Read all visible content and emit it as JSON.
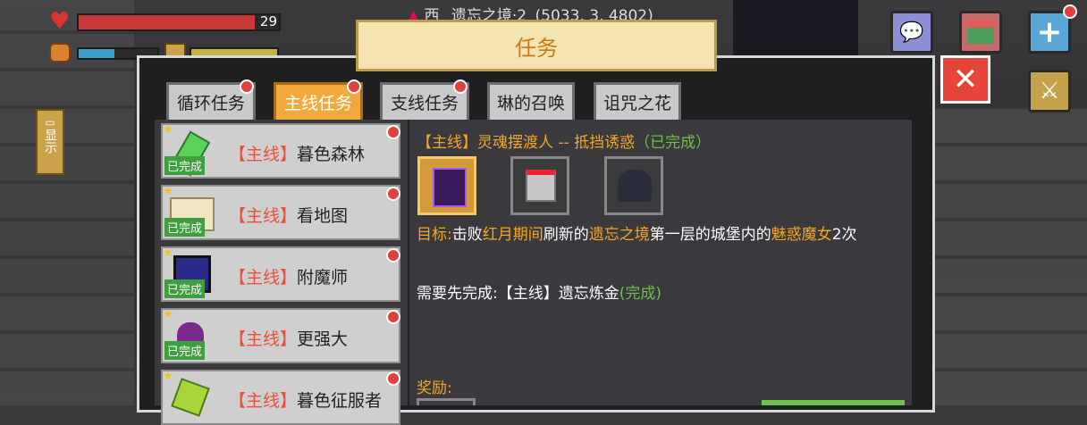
{
  "location": {
    "direction": "西",
    "name": "遗忘之境·2",
    "coords": "(5033, 3, 4802)"
  },
  "hud": {
    "health_value": "29"
  },
  "dialog_title": "任务",
  "tabs": [
    {
      "label": "循环任务",
      "active": false,
      "dot": true
    },
    {
      "label": "主线任务",
      "active": true,
      "dot": true
    },
    {
      "label": "支线任务",
      "active": false,
      "dot": true
    },
    {
      "label": "琳的召唤",
      "active": false,
      "dot": false
    },
    {
      "label": "诅咒之花",
      "active": false,
      "dot": false
    }
  ],
  "quests": [
    {
      "tag": "【主线】",
      "name": "暮色森林",
      "status": "已完成",
      "icon": "green-key-icon"
    },
    {
      "tag": "【主线】",
      "name": "看地图",
      "status": "已完成",
      "icon": "map-scroll-icon"
    },
    {
      "tag": "【主线】",
      "name": "附魔师",
      "status": "已完成",
      "icon": "enchant-cube-icon"
    },
    {
      "tag": "【主线】",
      "name": "更强大",
      "status": "已完成",
      "icon": "grape-icon"
    },
    {
      "tag": "【主线】",
      "name": "暮色征服者",
      "status": "",
      "icon": "green-gem-icon"
    }
  ],
  "detail": {
    "header_tag": "【主线】",
    "header_title": "灵魂摆渡人 -- 抵挡诱惑",
    "header_status": "（已完成）",
    "goal_label": "目标:",
    "goal_parts": [
      "击败",
      "红月期间",
      "刷新的",
      "遗忘之境",
      "第一层的城堡内的",
      "魅惑",
      "魔女",
      "2次"
    ],
    "prereq_label": "需要先完成:",
    "prereq_quest": "【主线】遗忘炼金",
    "prereq_status": "(完成)",
    "reward_label": "奖励:"
  },
  "side_hint": "显示",
  "colors": {
    "accent": "#f0a93a",
    "highlight": "#f5a623",
    "done_green": "#6cc04a",
    "tag_red": "#e8503a"
  }
}
